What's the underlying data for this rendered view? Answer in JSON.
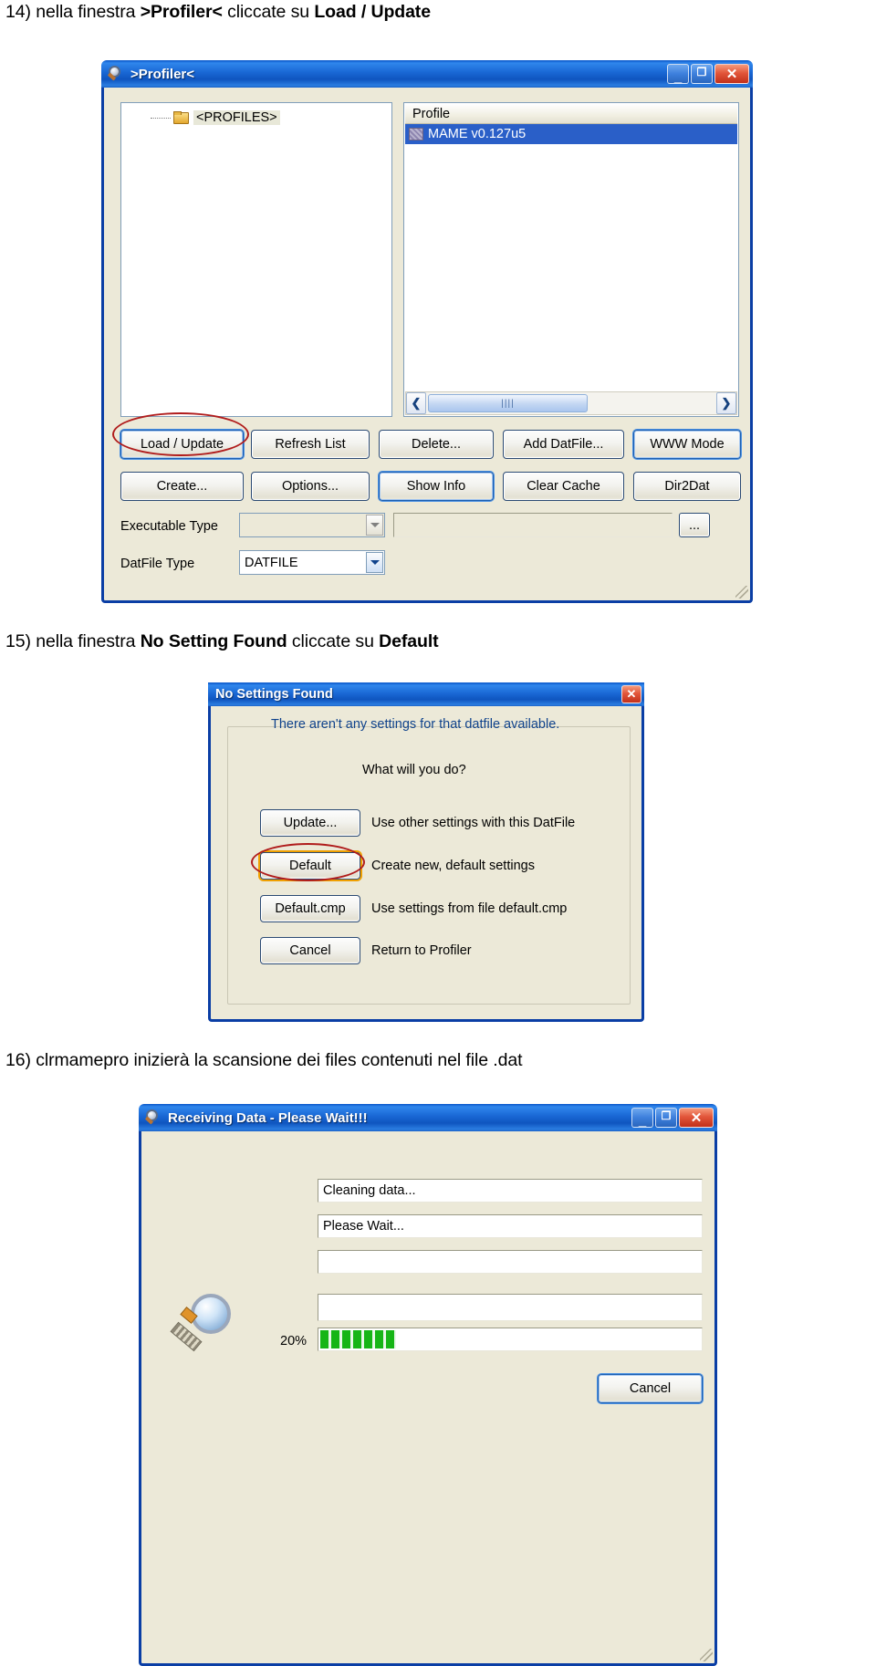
{
  "steps": [
    {
      "id": "step14",
      "number": "14)",
      "parts": [
        {
          "t": " nella finestra ",
          "b": false
        },
        {
          "t": ">Profiler<",
          "b": true
        },
        {
          "t": " cliccate su ",
          "b": false
        },
        {
          "t": "Load / Update",
          "b": true
        }
      ],
      "plain": "14) nella finestra >Profiler< cliccate su Load / Update"
    },
    {
      "id": "step15",
      "number": "15)",
      "plain": "15) nella finestra No Setting Found cliccate su Default"
    },
    {
      "id": "step16",
      "number": "16)",
      "plain": "16) clrmamepro inizierà la scansione dei files contenuti nel file .dat"
    }
  ],
  "profiler_window": {
    "title": ">Profiler<",
    "icon": "magnifier-icon",
    "window_buttons": {
      "minimize": "_",
      "maximize": "❐",
      "close": "✕"
    },
    "tree": {
      "root_label": "<PROFILES>",
      "folder_icon": "folder-icon"
    },
    "list": {
      "column_header": "Profile",
      "rows": [
        {
          "label": "MAME v0.127u5",
          "selected": true,
          "icon": "rom-icon"
        }
      ]
    },
    "hscrollbar": {
      "left_arrow": "❮",
      "right_arrow": "❯",
      "thumb_grip": "||||"
    },
    "buttons_row1": [
      {
        "label": "Load / Update",
        "focused": true,
        "annotated": true
      },
      {
        "label": "Refresh List",
        "focused": false,
        "annotated": false
      },
      {
        "label": "Delete...",
        "focused": false,
        "annotated": false
      },
      {
        "label": "Add DatFile...",
        "focused": false,
        "annotated": false
      },
      {
        "label": "WWW Mode",
        "focused": true,
        "annotated": false
      }
    ],
    "buttons_row2": [
      {
        "label": "Create...",
        "focused": false,
        "annotated": false
      },
      {
        "label": "Options...",
        "focused": false,
        "annotated": false
      },
      {
        "label": "Show Info",
        "focused": true,
        "annotated": false
      },
      {
        "label": "Clear Cache",
        "focused": false,
        "annotated": false
      },
      {
        "label": "Dir2Dat",
        "focused": false,
        "annotated": false
      }
    ],
    "fields": [
      {
        "label": "Executable Type",
        "combo_value": "",
        "disabled": true,
        "text_value": "",
        "browse_label": "..."
      },
      {
        "label": "DatFile Type",
        "combo_value": "DATFILE",
        "disabled": false
      }
    ]
  },
  "no_settings_dialog": {
    "title": "No Settings Found",
    "close_label": "✕",
    "description": "There aren't any settings for that datfile available.",
    "question": "What will you do?",
    "options": [
      {
        "button": "Update...",
        "text": "Use other settings with this DatFile",
        "highlighted": false
      },
      {
        "button": "Default",
        "text": "Create new, default settings",
        "highlighted": true
      },
      {
        "button": "Default.cmp",
        "text": "Use settings from file default.cmp",
        "highlighted": false
      },
      {
        "button": "Cancel",
        "text": "Return to Profiler",
        "highlighted": false
      }
    ]
  },
  "receiving_window": {
    "title": "Receiving Data - Please Wait!!!",
    "icon": "magnifier-icon",
    "window_buttons": {
      "minimize": "_",
      "maximize": "❐",
      "close": "✕"
    },
    "status_fields": [
      {
        "value": "Cleaning data..."
      },
      {
        "value": "Please Wait..."
      },
      {
        "value": ""
      },
      {
        "value": ""
      }
    ],
    "progress": {
      "percent_label": "20%",
      "percent_value": 20
    },
    "cancel_label": "Cancel",
    "graphic": "magnifier-icon"
  },
  "colors": {
    "title_blue": "#1967d4",
    "window_face": "#ece9d8",
    "selection_blue": "#2a5fc8",
    "annotation_red": "#b01c1c",
    "focus_orange": "#f0a000",
    "progress_green": "#16b516",
    "dialog_text_blue": "#10438c"
  }
}
